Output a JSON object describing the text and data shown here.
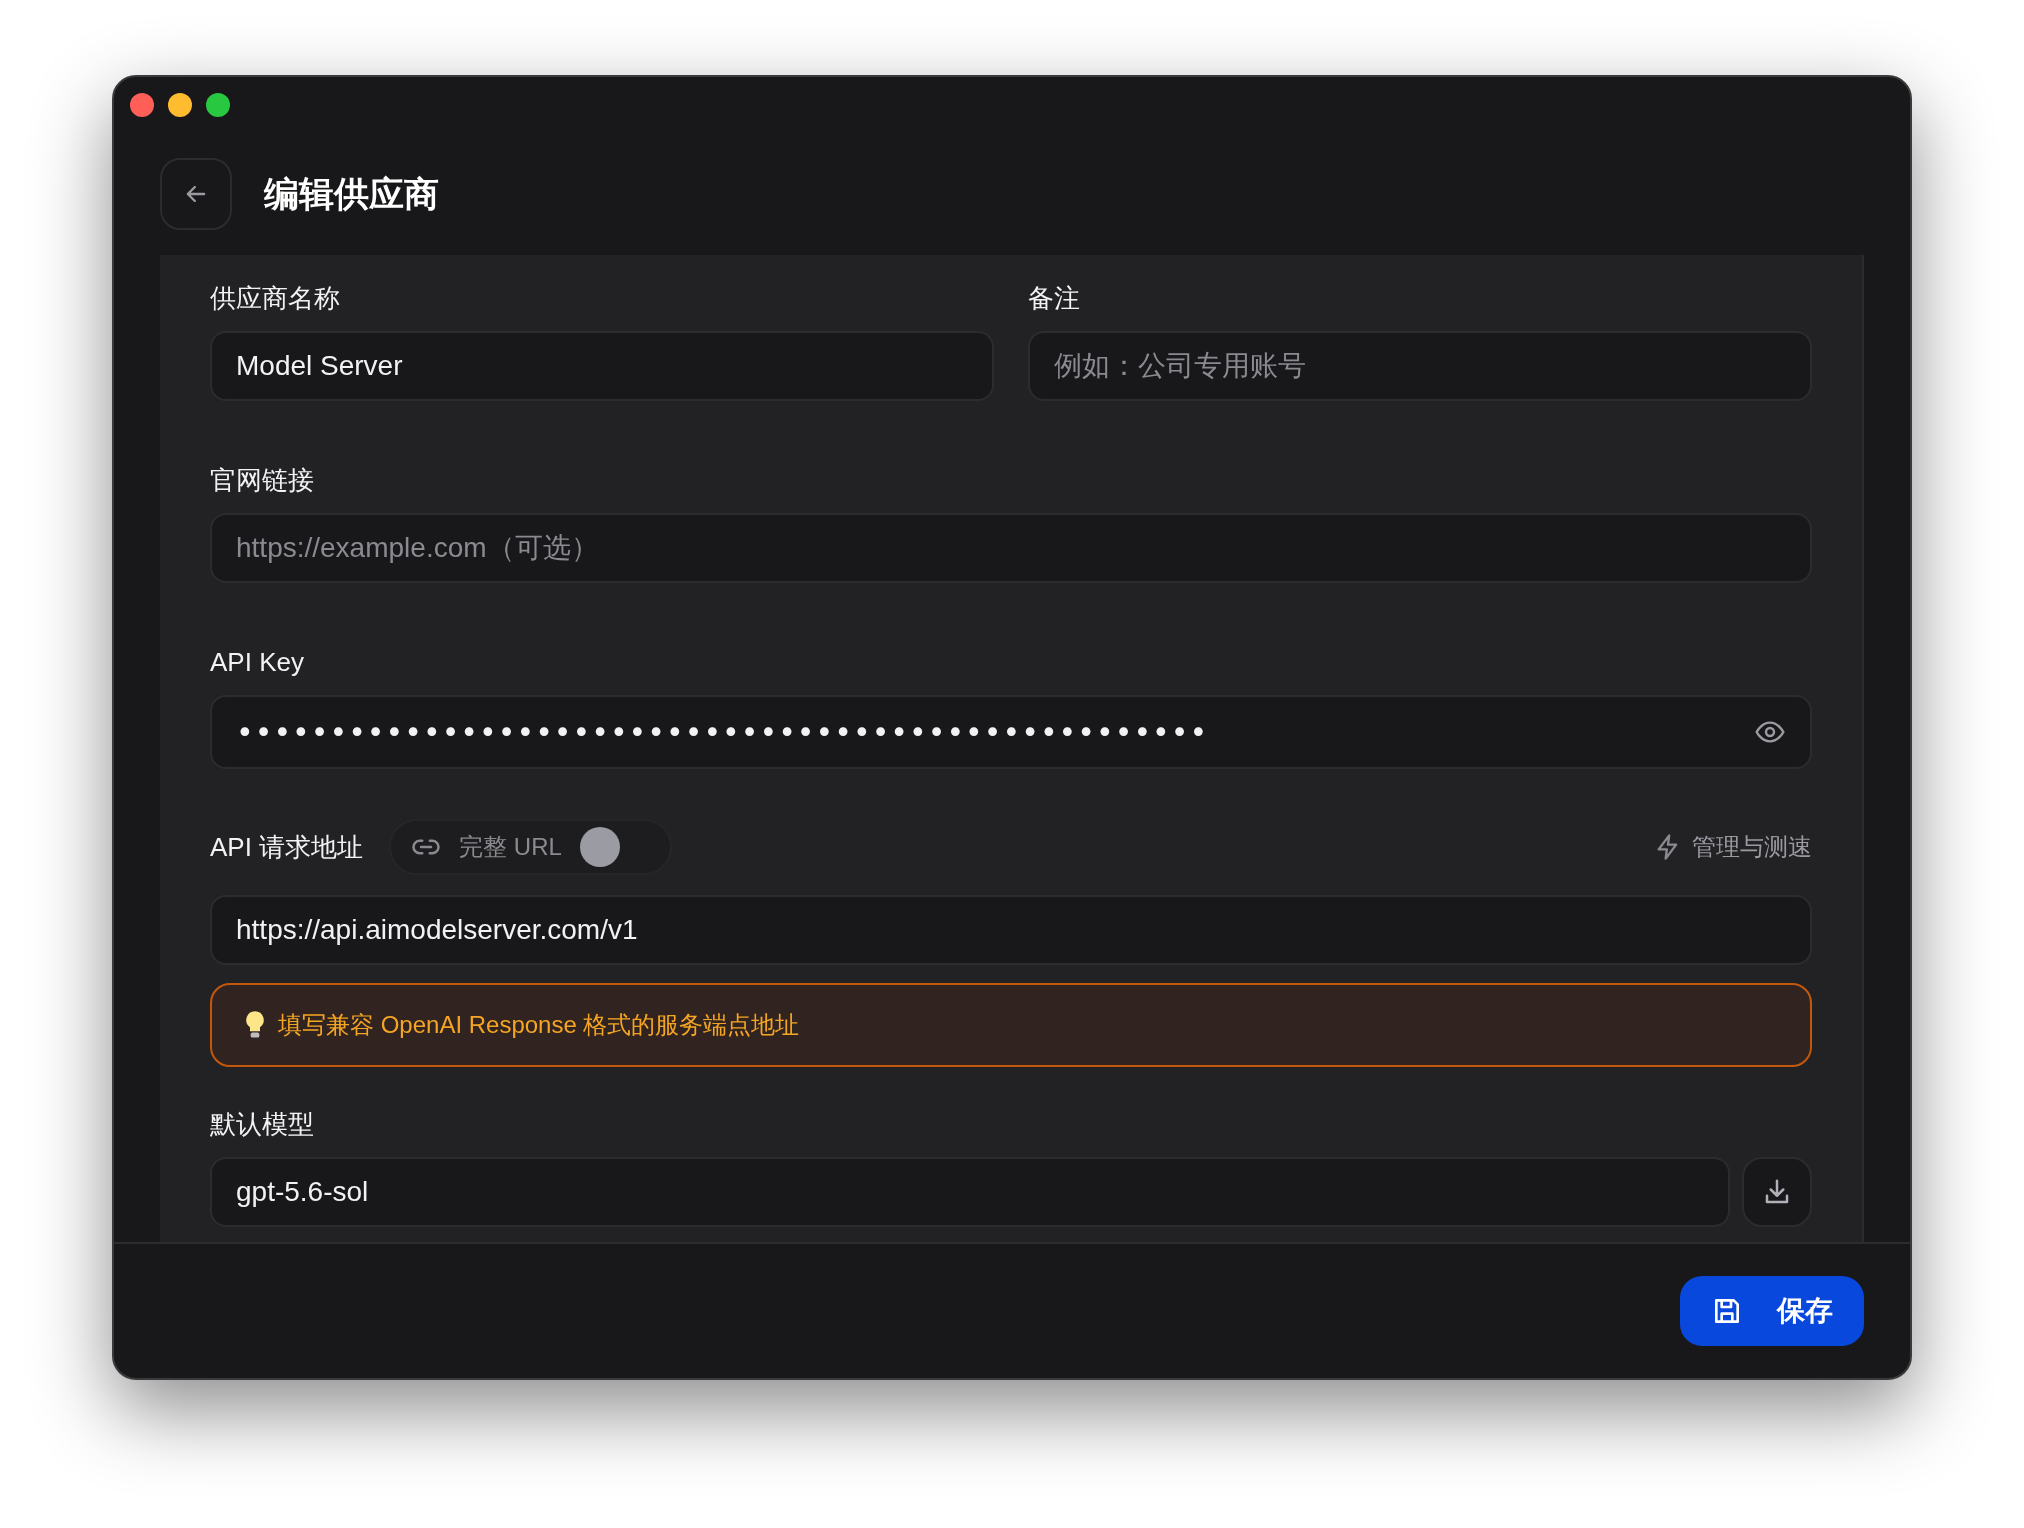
{
  "window": {
    "title": "编辑供应商"
  },
  "form": {
    "name": {
      "label": "供应商名称",
      "value": "Model Server"
    },
    "note": {
      "label": "备注",
      "placeholder": "例如：公司专用账号"
    },
    "website": {
      "label": "官网链接",
      "placeholder": "https://example.com（可选）"
    },
    "api_key": {
      "label": "API Key",
      "value": "••••••••••••••••••••••••••••••••••••••••••••••••••••"
    },
    "endpoint": {
      "label": "API 请求地址",
      "full_url_toggle": {
        "label": "完整 URL",
        "on": false
      },
      "manage_link": "管理与测速",
      "value": "https://api.aimodelserver.com/v1",
      "hint": "填写兼容 OpenAI Response 格式的服务端点地址"
    },
    "default_model": {
      "label": "默认模型",
      "value": "gpt-5.6-sol"
    }
  },
  "footer": {
    "save_button": "保存"
  }
}
